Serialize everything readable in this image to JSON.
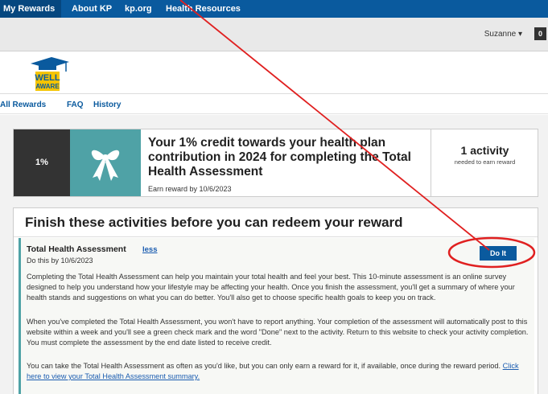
{
  "topnav": {
    "items": [
      "My Rewards",
      "About KP",
      "kp.org",
      "Health Resources"
    ]
  },
  "userbar": {
    "user_name": "Suzanne ▾",
    "badge_count": "0"
  },
  "logo": {
    "line1": "WELL",
    "line2": "AWARE"
  },
  "subnav": {
    "links": [
      "All Rewards",
      "FAQ",
      "History"
    ]
  },
  "reward_card": {
    "percent": "1%",
    "icon": "gift-bow-icon",
    "title": "Your 1% credit towards your health plan contribution in 2024 for completing the Total Health Assessment",
    "earn_by": "Earn reward by 10/6/2023",
    "activity_count": "1 activity",
    "activity_needed": "needed to earn reward"
  },
  "activities_panel": {
    "title": "Finish these activities before you can redeem your reward",
    "activity": {
      "name": "Total Health Assessment",
      "toggle_label": "less",
      "due": "Do this by 10/6/2023",
      "button_label": "Do It",
      "paragraph1": "Completing the Total Health Assessment can help you maintain your total health and feel your best. This 10-minute assessment is an online survey designed to help you understand how your lifestyle may be affecting your health. Once you finish the assessment, you'll get a summary of where your health stands and suggestions on what you can do better. You'll also get to choose specific health goals to keep you on track.",
      "paragraph2": "When you've completed the Total Health Assessment, you won't have to report anything. Your completion of the assessment will automatically post to this website within a week and you'll see a green check mark and the word \"Done\" next to the activity. Return to this website to check your activity completion. You must complete the assessment by the end date listed to receive credit.",
      "paragraph3": "You can take the Total Health Assessment as often as you'd like, but you can only earn a reward for it, if available, once during the reward period.",
      "summary_link": "Click here to view your Total Health Assessment summary."
    }
  },
  "colors": {
    "nav_blue": "#0a5a9e",
    "teal": "#4fa2a6",
    "annotation_red": "#e02020"
  }
}
